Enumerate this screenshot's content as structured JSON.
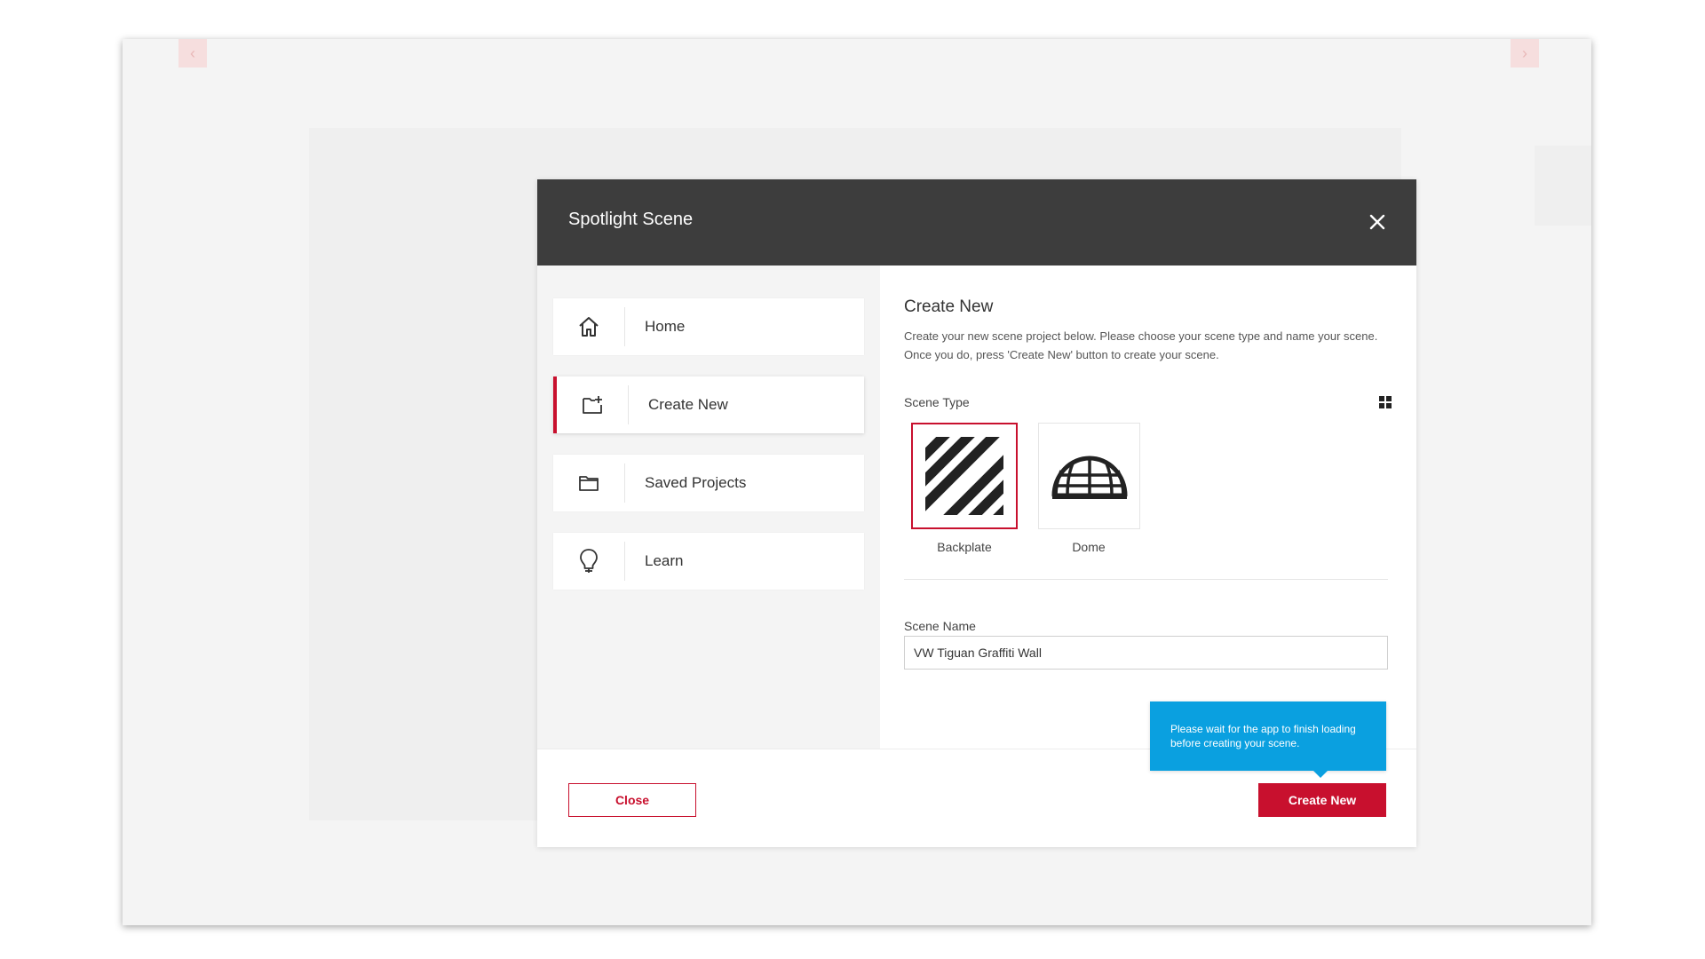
{
  "dialog": {
    "title": "Spotlight Scene",
    "close_icon": "close-icon"
  },
  "sidebar": {
    "items": [
      {
        "label": "Home",
        "icon": "home-icon"
      },
      {
        "label": "Create New",
        "icon": "folder-add-icon",
        "active": true
      },
      {
        "label": "Saved Projects",
        "icon": "folder-icon"
      },
      {
        "label": "Learn",
        "icon": "lightbulb-icon"
      }
    ]
  },
  "main": {
    "title": "Create New",
    "description": "Create your new scene project below. Please choose your scene type and name your scene. Once you do, press 'Create New' button to create your scene.",
    "scene_type_label": "Scene Type",
    "scene_types": [
      {
        "label": "Backplate",
        "icon": "backplate-icon",
        "selected": true
      },
      {
        "label": "Dome",
        "icon": "dome-icon",
        "selected": false
      }
    ],
    "scene_name_label": "Scene Name",
    "scene_name_value": "VW Tiguan Graffiti Wall"
  },
  "footer": {
    "close_label": "Close",
    "create_label": "Create New",
    "tooltip_text": "Please wait for the app to finish loading before creating your scene."
  },
  "colors": {
    "accent": "#c8102e",
    "header_bg": "#3d3d3d",
    "tooltip_bg": "#0aa0e0"
  }
}
